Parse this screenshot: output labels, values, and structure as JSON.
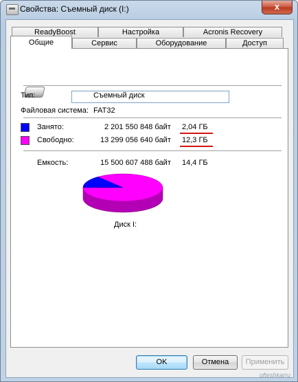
{
  "window": {
    "title": "Свойства: Съемный диск (I:)",
    "close_label": "x"
  },
  "tabs": {
    "row1": [
      "ReadyBoost",
      "Настройка",
      "Acronis Recovery"
    ],
    "row2": [
      "Общие",
      "Сервис",
      "Оборудование",
      "Доступ"
    ],
    "active": "Общие"
  },
  "general": {
    "name_value": "",
    "type_label": "Тип:",
    "type_value": "Съемный диск",
    "fs_label": "Файловая система:",
    "fs_value": "FAT32",
    "used_label": "Занято:",
    "used_bytes": "2 201 550 848 байт",
    "used_gb": "2,04 ГБ",
    "free_label": "Свободно:",
    "free_bytes": "13 299 056 640 байт",
    "free_gb": "12,3 ГБ",
    "capacity_label": "Емкость:",
    "capacity_bytes": "15 500 607 488 байт",
    "capacity_gb": "14,4 ГБ",
    "disk_label": "Диск I:",
    "used_fraction": 0.142,
    "colors": {
      "used": "#0000ff",
      "free": "#ff00ff",
      "underline": "#d21515"
    }
  },
  "buttons": {
    "ok": "OK",
    "cancel": "Отмена",
    "apply": "Применить"
  },
  "watermark": "ofteshkarru"
}
